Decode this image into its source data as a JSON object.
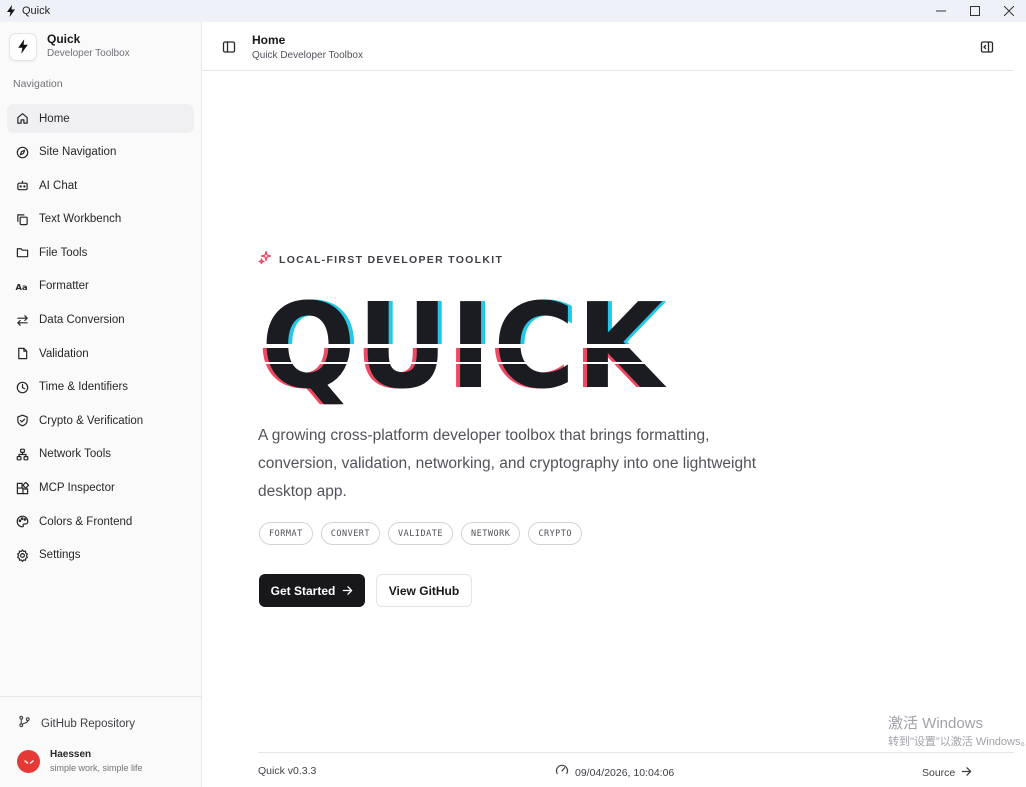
{
  "window": {
    "title": "Quick"
  },
  "sidebar": {
    "brand": {
      "title": "Quick",
      "subtitle": "Developer Toolbox"
    },
    "nav_heading": "Navigation",
    "items": [
      {
        "label": "Home",
        "icon": "home-icon",
        "active": true
      },
      {
        "label": "Site Navigation",
        "icon": "compass-icon"
      },
      {
        "label": "AI Chat",
        "icon": "bot-icon"
      },
      {
        "label": "Text Workbench",
        "icon": "copy-icon"
      },
      {
        "label": "File Tools",
        "icon": "folder-icon"
      },
      {
        "label": "Formatter",
        "icon": "type-icon"
      },
      {
        "label": "Data Conversion",
        "icon": "arrows-icon"
      },
      {
        "label": "Validation",
        "icon": "file-check-icon"
      },
      {
        "label": "Time & Identifiers",
        "icon": "clock-icon"
      },
      {
        "label": "Crypto & Verification",
        "icon": "shield-icon"
      },
      {
        "label": "Network Tools",
        "icon": "network-icon"
      },
      {
        "label": "MCP Inspector",
        "icon": "blocks-icon"
      },
      {
        "label": "Colors & Frontend",
        "icon": "palette-icon"
      },
      {
        "label": "Settings",
        "icon": "gear-icon"
      }
    ],
    "github_label": "GitHub Repository",
    "user": {
      "name": "Haessen",
      "tagline": "simple work, simple life"
    }
  },
  "header": {
    "title": "Home",
    "subtitle": "Quick Developer Toolbox"
  },
  "hero": {
    "eyebrow": "LOCAL-FIRST DEVELOPER TOOLKIT",
    "logo_text": "QUICK",
    "description": "A growing cross-platform developer toolbox that brings formatting, conversion, validation, networking, and cryptography into one lightweight desktop app.",
    "tags": [
      "FORMAT",
      "CONVERT",
      "VALIDATE",
      "NETWORK",
      "CRYPTO"
    ],
    "primary_button": "Get Started",
    "secondary_button": "View GitHub"
  },
  "footer": {
    "version": "Quick v0.3.3",
    "datetime": "09/04/2026, 10:04:06",
    "source_label": "Source"
  },
  "watermark": {
    "line1": "激活 Windows",
    "line2": "转到\"设置\"以激活 Windows。"
  },
  "colors": {
    "accent_cyan": "#22c8e6",
    "accent_red": "#ec4a62",
    "ink": "#1b1c22",
    "active_bg": "#f0f0f2"
  }
}
